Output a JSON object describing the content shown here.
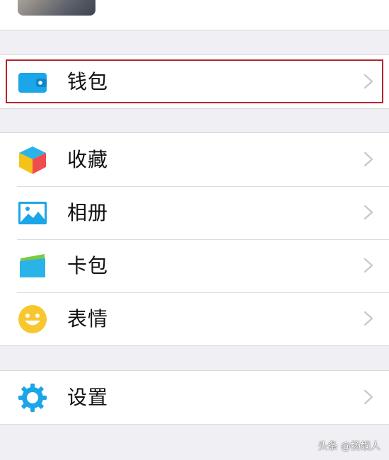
{
  "menu": {
    "wallet": {
      "label": "钱包",
      "icon": "wallet-icon"
    },
    "favorites": {
      "label": "收藏",
      "icon": "cube-icon"
    },
    "album": {
      "label": "相册",
      "icon": "picture-icon"
    },
    "cards": {
      "label": "卡包",
      "icon": "card-icon"
    },
    "stickers": {
      "label": "表情",
      "icon": "smiley-icon"
    },
    "settings": {
      "label": "设置",
      "icon": "gear-icon"
    }
  },
  "watermark": "头条 @扬娱人",
  "colors": {
    "accent_blue": "#1aa6e8",
    "highlight_red": "#b5262e",
    "background": "#efeff4",
    "chevron": "#c7c7cc"
  }
}
